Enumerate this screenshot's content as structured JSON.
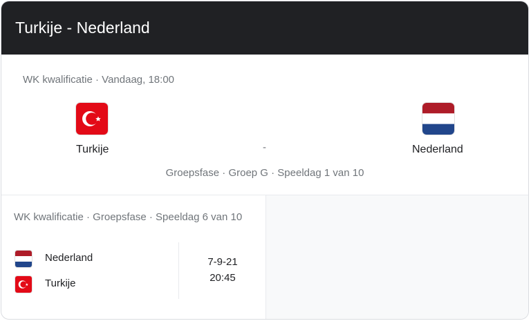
{
  "header": {
    "title": "Turkije - Nederland"
  },
  "match": {
    "competition_line": "WK kwalificatie · Vandaag, 18:00",
    "home": {
      "name": "Turkije",
      "flag_icon": "turkey-flag-icon"
    },
    "away": {
      "name": "Nederland",
      "flag_icon": "netherlands-flag-icon"
    },
    "separator": "-",
    "stage_line": "Groepsfase · Groep G · Speeldag 1 van 10"
  },
  "history": {
    "competition_line": "WK kwalificatie · Groepsfase · Speeldag 6 van 10",
    "teams": [
      {
        "name": "Nederland",
        "flag_icon": "netherlands-flag-icon"
      },
      {
        "name": "Turkije",
        "flag_icon": "turkey-flag-icon"
      }
    ],
    "date": "7-9-21",
    "time": "20:45"
  },
  "colors": {
    "header_bg": "#202124",
    "turkey_red": "#e30a17",
    "nl_red": "#ae1c28",
    "nl_blue": "#21468b"
  }
}
